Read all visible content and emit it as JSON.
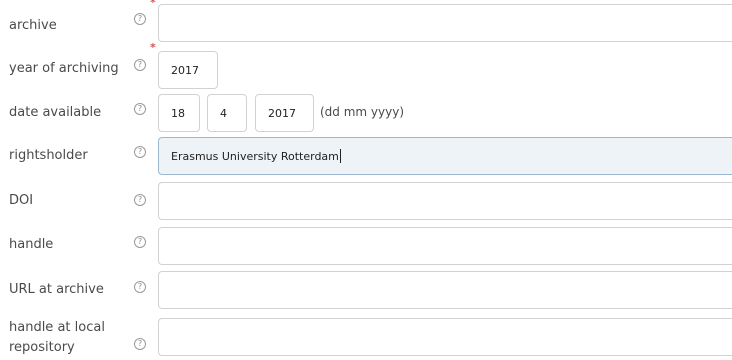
{
  "fields": {
    "archive": {
      "label": "archive",
      "value": ""
    },
    "year_of_archiving": {
      "label": "year of archiving",
      "value": "2017"
    },
    "date_available": {
      "label": "date available",
      "day": "18",
      "month": "4",
      "year": "2017",
      "format_hint": "(dd mm yyyy)"
    },
    "rightsholder": {
      "label": "rightsholder",
      "value": "Erasmus University Rotterdam"
    },
    "doi": {
      "label": "DOI",
      "value": ""
    },
    "handle": {
      "label": "handle",
      "value": ""
    },
    "url_at_archive": {
      "label": "URL at archive",
      "value": ""
    },
    "handle_at_local_repository": {
      "label": "handle at local repository",
      "value": ""
    }
  },
  "help_glyph": "?",
  "required_marker": "*",
  "colors": {
    "required": "#d9534f",
    "focused_input_bg": "#eef3f8",
    "border": "#d2d2d2"
  }
}
